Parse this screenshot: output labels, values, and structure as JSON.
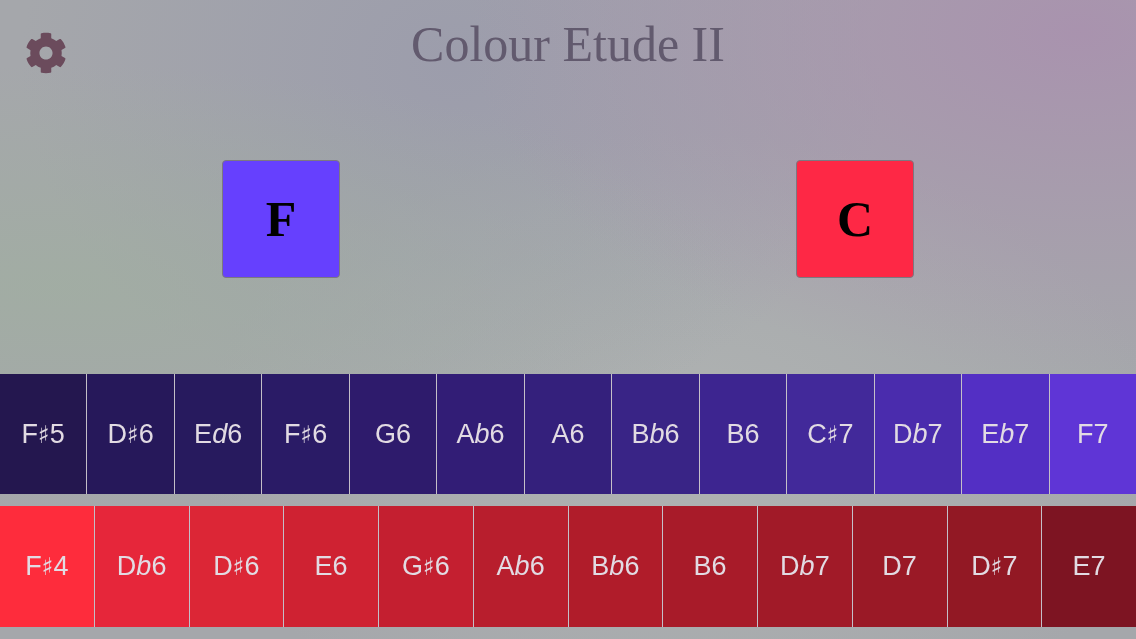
{
  "header": {
    "title": "Colour Etude II"
  },
  "tiles": [
    {
      "label": "F",
      "color": "#6640fe"
    },
    {
      "label": "C",
      "color": "#fe2845"
    }
  ],
  "keyboards": [
    {
      "keys": [
        {
          "note": "F",
          "sharp": "♯",
          "octave": "5",
          "color": "#24174f"
        },
        {
          "note": "D",
          "sharp": "♯",
          "octave": "6",
          "color": "#26185a"
        },
        {
          "note": "E",
          "flat": "d",
          "octave": "6",
          "color": "#271a5e"
        },
        {
          "note": "F",
          "sharp": "♯",
          "octave": "6",
          "color": "#2a1b66"
        },
        {
          "note": "G",
          "octave": "6",
          "color": "#2e1b6c"
        },
        {
          "note": "A",
          "flat": "b",
          "octave": "6",
          "color": "#321d76"
        },
        {
          "note": "A",
          "octave": "6",
          "color": "#34207c"
        },
        {
          "note": "B",
          "flat": "b",
          "octave": "6",
          "color": "#392486"
        },
        {
          "note": "B",
          "octave": "6",
          "color": "#3d2590"
        },
        {
          "note": "C",
          "sharp": "♯",
          "octave": "7",
          "color": "#42299a"
        },
        {
          "note": "D",
          "flat": "b",
          "octave": "7",
          "color": "#4a2cad"
        },
        {
          "note": "E",
          "flat": "b",
          "octave": "7",
          "color": "#532fc4"
        },
        {
          "note": "F",
          "octave": "7",
          "color": "#5f35d6"
        }
      ]
    },
    {
      "keys": [
        {
          "note": "F",
          "sharp": "♯",
          "octave": "4",
          "color": "#fe2c3c"
        },
        {
          "note": "D",
          "flat": "b",
          "octave": "6",
          "color": "#e6263a"
        },
        {
          "note": "D",
          "sharp": "♯",
          "octave": "6",
          "color": "#dc2636"
        },
        {
          "note": "E",
          "octave": "6",
          "color": "#cf2232"
        },
        {
          "note": "G",
          "sharp": "♯",
          "octave": "6",
          "color": "#c41f30"
        },
        {
          "note": "A",
          "flat": "b",
          "octave": "6",
          "color": "#b81e2d"
        },
        {
          "note": "B",
          "flat": "b",
          "octave": "6",
          "color": "#b01c2a"
        },
        {
          "note": "B",
          "octave": "6",
          "color": "#a81b29"
        },
        {
          "note": "D",
          "flat": "b",
          "octave": "7",
          "color": "#a11a28"
        },
        {
          "note": "D",
          "octave": "7",
          "color": "#9a1926"
        },
        {
          "note": "D",
          "sharp": "♯",
          "octave": "7",
          "color": "#921824"
        },
        {
          "note": "E",
          "octave": "7",
          "color": "#7d1422"
        }
      ]
    }
  ]
}
